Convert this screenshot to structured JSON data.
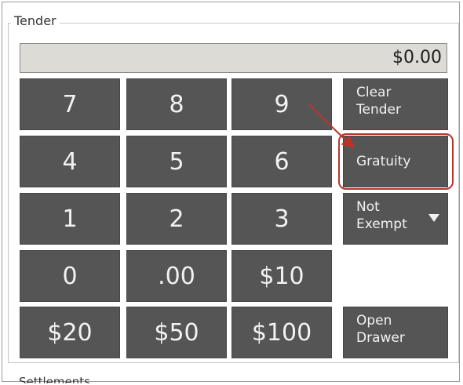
{
  "group": {
    "legend": "Tender"
  },
  "display": {
    "amount": "$0.00"
  },
  "keypad": {
    "rows": [
      [
        "7",
        "8",
        "9"
      ],
      [
        "4",
        "5",
        "6"
      ],
      [
        "1",
        "2",
        "3"
      ],
      [
        "0",
        ".00",
        "$10"
      ],
      [
        "$20",
        "$50",
        "$100"
      ]
    ]
  },
  "functions": {
    "clear_tender": "Clear\nTender",
    "gratuity": "Gratuity",
    "not_exempt": "Not\nExempt",
    "open_drawer": "Open\nDrawer"
  },
  "annotation": {
    "highlight_color": "#b8342b"
  },
  "next_section": {
    "label": "Settlements"
  },
  "colors": {
    "key_bg": "#555555",
    "key_text": "#f2f2f2",
    "display_bg": "#dddbd6"
  }
}
